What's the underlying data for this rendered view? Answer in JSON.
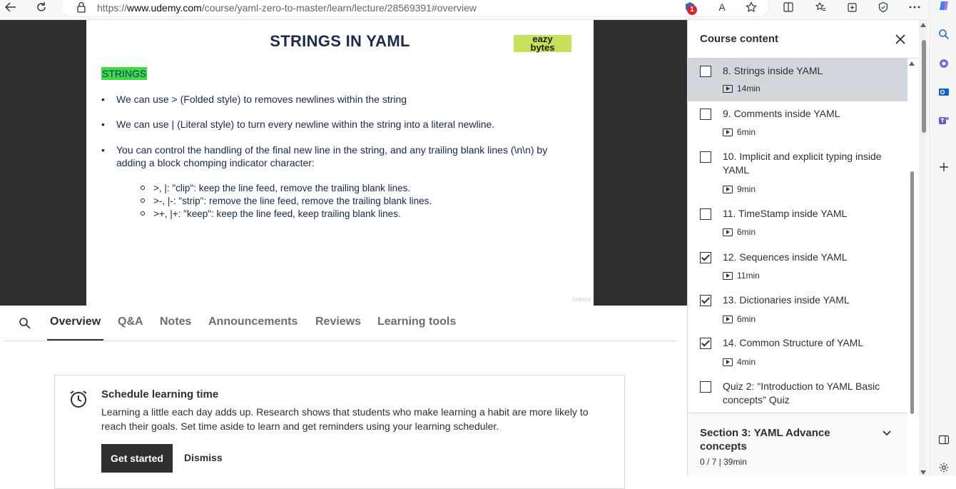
{
  "browser": {
    "url_prefix": "https://",
    "url_host": "www.udemy.com",
    "url_path": "/course/yaml-zero-to-master/learn/lecture/28569391#overview",
    "notification_count": "1",
    "read_aloud_label": "A"
  },
  "slide": {
    "title": "STRINGS IN YAML",
    "logo_line1": "eazy",
    "logo_line2": "bytes",
    "highlight": "STRINGS",
    "bullets": [
      "We can use > (Folded style) to removes newlines within the string",
      "We can use | (Literal style) to turn every newline within the string into a literal newline.",
      "You can control the handling of the final new line in the string, and any trailing blank lines (\\n\\n) by adding a block chomping indicator character:"
    ],
    "sub_bullets": [
      ">, |: \"clip\": keep the line feed, remove the trailing blank lines.",
      ">-, |-: \"strip\": remove the line feed, remove the trailing blank lines.",
      ">+, |+: \"keep\": keep the line feed, keep trailing blank lines."
    ],
    "watermark": "Udemy"
  },
  "tabs": [
    "Overview",
    "Q&A",
    "Notes",
    "Announcements",
    "Reviews",
    "Learning tools"
  ],
  "card": {
    "title": "Schedule learning time",
    "text": "Learning a little each day adds up. Research shows that students who make learning a habit are more likely to reach their goals. Set time aside to learn and get reminders using your learning scheduler.",
    "primary_label": "Get started",
    "secondary_label": "Dismiss"
  },
  "sidebar": {
    "title": "Course content",
    "items": [
      {
        "title": "8. Strings inside YAML",
        "duration": "14min",
        "checked": false,
        "selected": true
      },
      {
        "title": "9. Comments inside YAML",
        "duration": "6min",
        "checked": false,
        "selected": false
      },
      {
        "title": "10. Implicit and explicit typing inside YAML",
        "duration": "9min",
        "checked": false,
        "selected": false
      },
      {
        "title": "11. TimeStamp inside YAML",
        "duration": "6min",
        "checked": false,
        "selected": false
      },
      {
        "title": "12. Sequences inside YAML",
        "duration": "11min",
        "checked": true,
        "selected": false
      },
      {
        "title": "13. Dictionaries inside YAML",
        "duration": "6min",
        "checked": true,
        "selected": false
      },
      {
        "title": "14. Common Structure of YAML",
        "duration": "4min",
        "checked": true,
        "selected": false
      },
      {
        "title": "Quiz 2: \"Introduction to YAML Basic concepts\" Quiz",
        "duration": "",
        "checked": false,
        "selected": false
      }
    ],
    "section": {
      "title": "Section 3: YAML Advance concepts",
      "meta": "0 / 7 | 39min"
    }
  }
}
